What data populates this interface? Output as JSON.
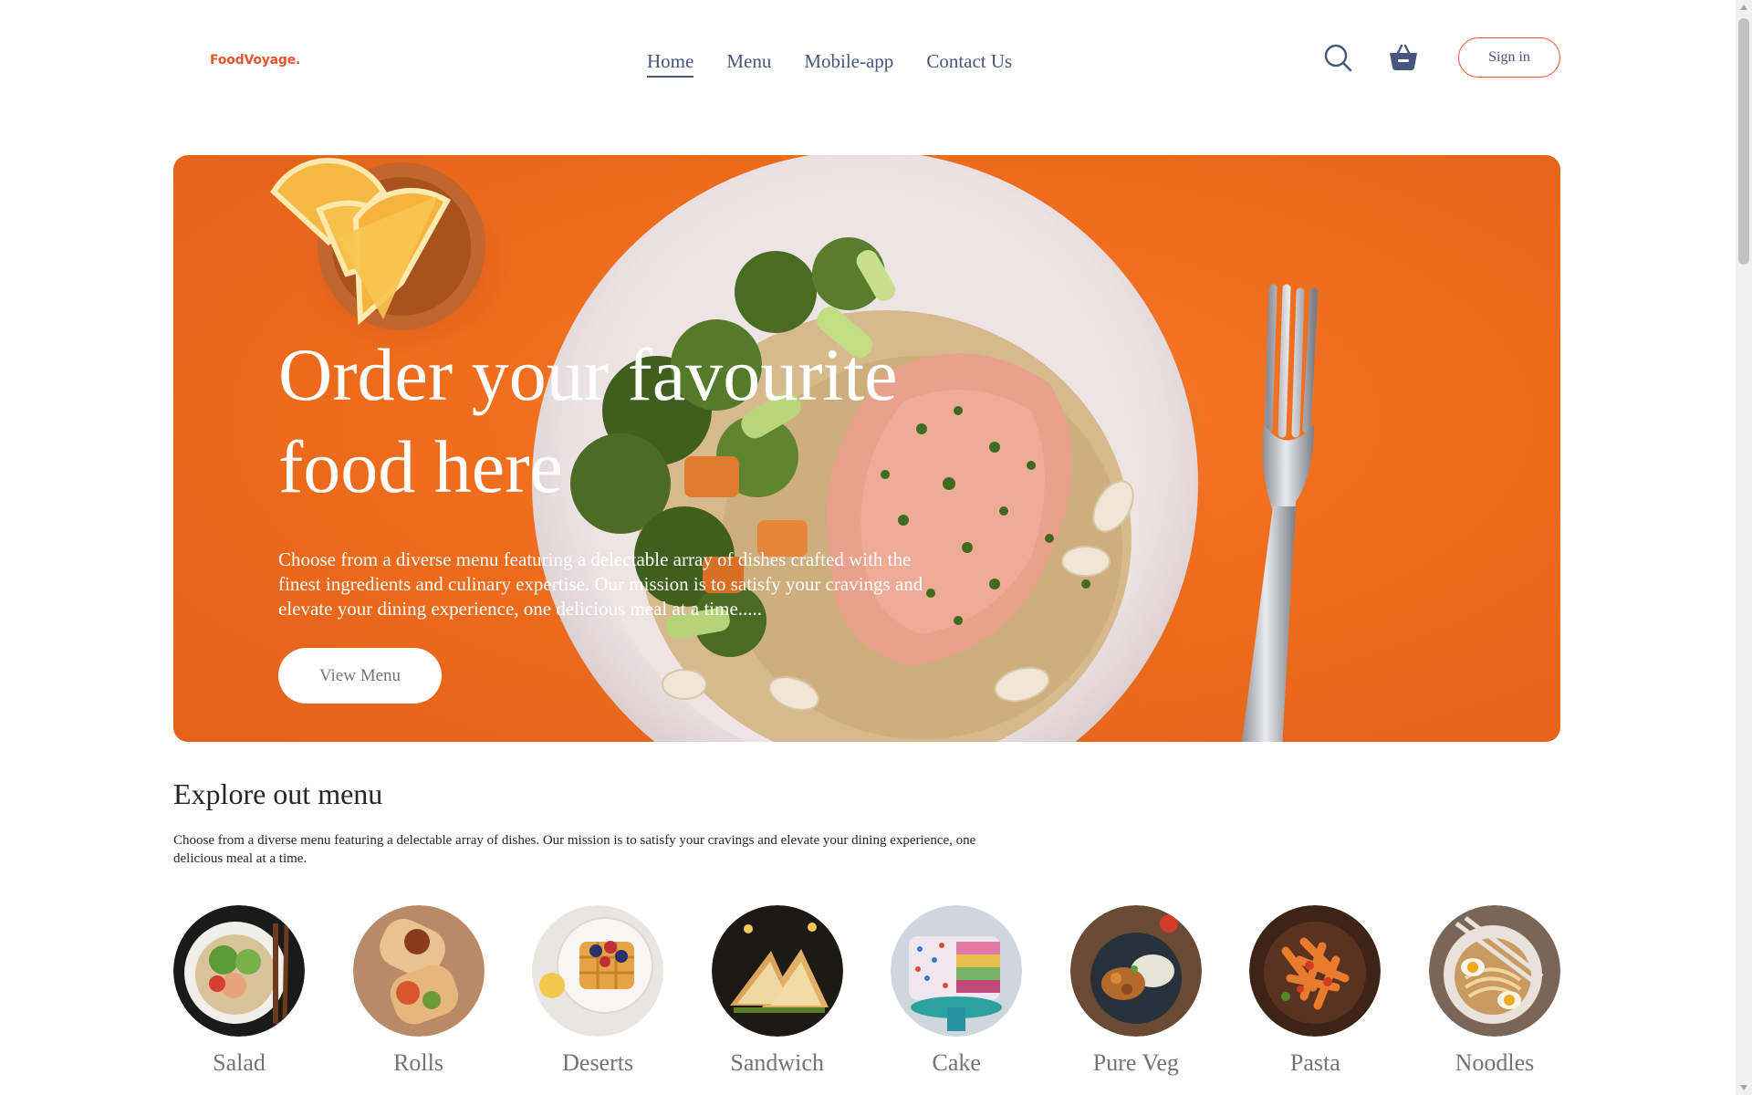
{
  "navbar": {
    "logo": "FoodVoyage.",
    "links": [
      {
        "label": "Home",
        "active": true
      },
      {
        "label": "Menu",
        "active": false
      },
      {
        "label": "Mobile-app",
        "active": false
      },
      {
        "label": "Contact Us",
        "active": false
      }
    ],
    "icons": [
      "search-icon",
      "basket-icon"
    ],
    "signin_label": "Sign in"
  },
  "hero": {
    "title": "Order your favourite food here",
    "description": "Choose from a diverse menu featuring a delectable array of dishes crafted with the finest ingredients and culinary expertise. Our mission is to satisfy your cravings and elevate your dining experience, one delicious meal at a time.....",
    "button_label": "View Menu"
  },
  "explore": {
    "title": "Explore out menu",
    "description": "Choose from a diverse menu featuring a delectable array of dishes. Our mission is to satisfy your cravings and elevate your dining experience, one delicious meal at a time.",
    "items": [
      {
        "label": "Salad"
      },
      {
        "label": "Rolls"
      },
      {
        "label": "Deserts"
      },
      {
        "label": "Sandwich"
      },
      {
        "label": "Cake"
      },
      {
        "label": "Pure Veg"
      },
      {
        "label": "Pasta"
      },
      {
        "label": "Noodles"
      }
    ]
  },
  "colors": {
    "brand": "#e8542b",
    "nav_text": "#49557e",
    "hero_bg": "#ef6d1d",
    "muted_text": "#747474"
  }
}
